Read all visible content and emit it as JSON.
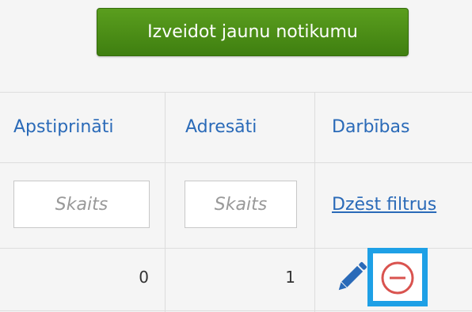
{
  "header": {
    "create_button_label": "Izveidot jaunu notikumu"
  },
  "table": {
    "columns": [
      "Apstiprināti",
      "Adresāti",
      "Darbības"
    ],
    "filters": {
      "confirmed_placeholder": "Skaits",
      "recipients_placeholder": "Skaits",
      "clear_filters_label": "Dzēst filtrus"
    },
    "rows": [
      {
        "confirmed": "0",
        "recipients": "1",
        "actions": [
          "pencil-icon",
          "minus-circle-icon"
        ]
      }
    ]
  },
  "colors": {
    "button_green": "#4a8c16",
    "link_blue": "#2a6ab8",
    "delete_red": "#d9534f",
    "highlight_blue": "#1ea0e6"
  }
}
